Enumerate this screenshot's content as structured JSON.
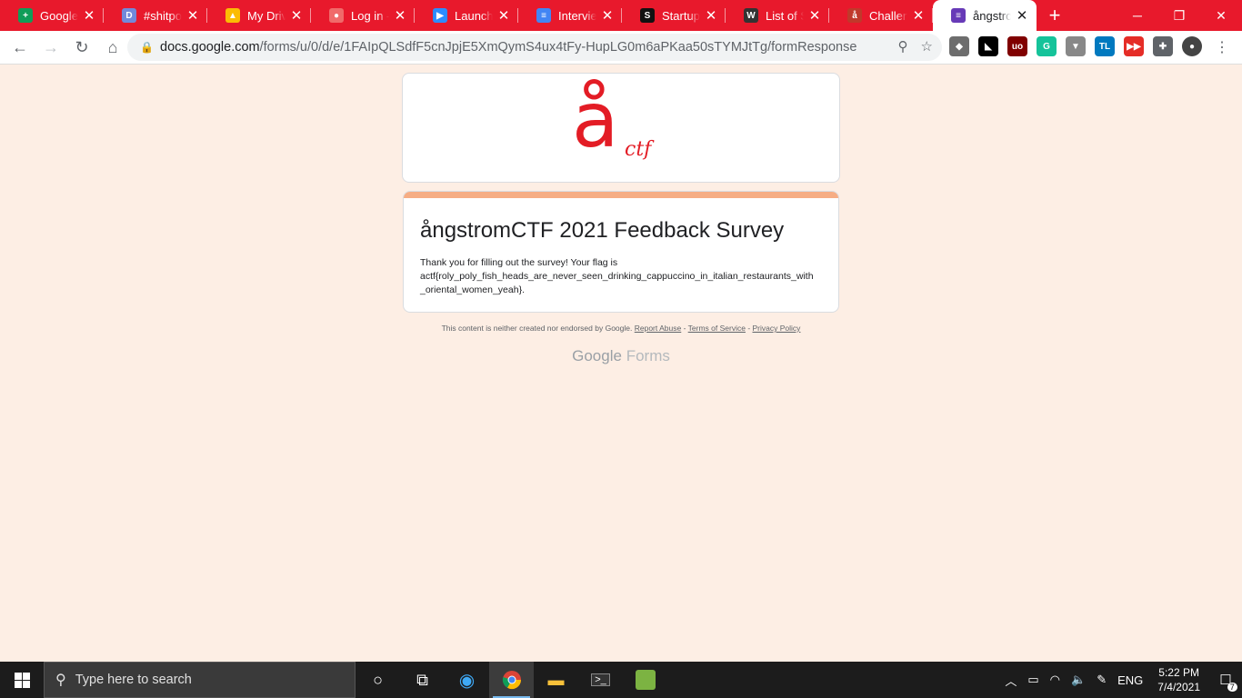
{
  "browser": {
    "tabs": [
      {
        "title": "Google Si",
        "color": "#0f9d58",
        "glyph": "+"
      },
      {
        "title": "#shitpost",
        "color": "#7289da",
        "glyph": "D"
      },
      {
        "title": "My Drive",
        "color": "#fbbc04",
        "glyph": "▲"
      },
      {
        "title": "Log in - A",
        "color": "#f06a6a",
        "glyph": "●"
      },
      {
        "title": "Launch M",
        "color": "#2d8cff",
        "glyph": "▶"
      },
      {
        "title": "Interview",
        "color": "#4285f4",
        "glyph": "≡"
      },
      {
        "title": "Startup Fa",
        "color": "#111111",
        "glyph": "S"
      },
      {
        "title": "List of Sir",
        "color": "#333333",
        "glyph": "W"
      },
      {
        "title": "Challenge",
        "color": "#c0392b",
        "glyph": "å"
      },
      {
        "title": "ångstrom",
        "color": "#673ab7",
        "glyph": "≡",
        "active": true
      }
    ],
    "close_glyph": "✕",
    "new_tab_glyph": "+",
    "window_controls": {
      "minimize": "─",
      "restore": "❐",
      "close": "✕"
    },
    "url": {
      "host": "docs.google.com",
      "path": "/forms/u/0/d/e/1FAIpQLSdfF5cnJpjE5XmQymS4ux4tFy-HupLG0m6aPKaa50sTYMJtTg/formResponse"
    },
    "nav": {
      "back": "←",
      "forward": "→",
      "reload": "↻",
      "home": "⌂"
    },
    "extensions": [
      {
        "name": "shield-ext-icon",
        "color": "#6d6d6d",
        "glyph": "◆"
      },
      {
        "name": "mask-ext-icon",
        "color": "#000000",
        "glyph": "◣"
      },
      {
        "name": "ublock-icon",
        "color": "#800000",
        "glyph": "uo"
      },
      {
        "name": "grammarly-icon",
        "color": "#15c39a",
        "glyph": "G"
      },
      {
        "name": "vue-ext-icon",
        "color": "#888888",
        "glyph": "▼"
      },
      {
        "name": "trello-icon",
        "color": "#0079bf",
        "glyph": "TL"
      },
      {
        "name": "video-ext-icon",
        "color": "#e52d27",
        "glyph": "▶▶"
      },
      {
        "name": "puzzle-icon",
        "color": "#5f6368",
        "glyph": "✚"
      },
      {
        "name": "profile-avatar",
        "color": "#444444",
        "glyph": "●"
      }
    ]
  },
  "form": {
    "logo_big": "å",
    "logo_small": "ctf",
    "title": "ångstromCTF 2021 Feedback Survey",
    "message_line1": "Thank you for filling out the survey! Your flag is",
    "message_line2": "actf{roly_poly_fish_heads_are_never_seen_drinking_cappuccino_in_italian_restaurants_with",
    "message_line3": "_oriental_women_yeah}.",
    "footer_text": "This content is neither created nor endorsed by Google.",
    "report_abuse": "Report Abuse",
    "terms": "Terms of Service",
    "privacy": "Privacy Policy",
    "sep": " - ",
    "brand_google": "Google",
    "brand_forms": "Forms"
  },
  "taskbar": {
    "search_placeholder": "Type here to search",
    "time": "5:22 PM",
    "date": "7/4/2021",
    "language": "ENG",
    "notification_count": "7"
  }
}
